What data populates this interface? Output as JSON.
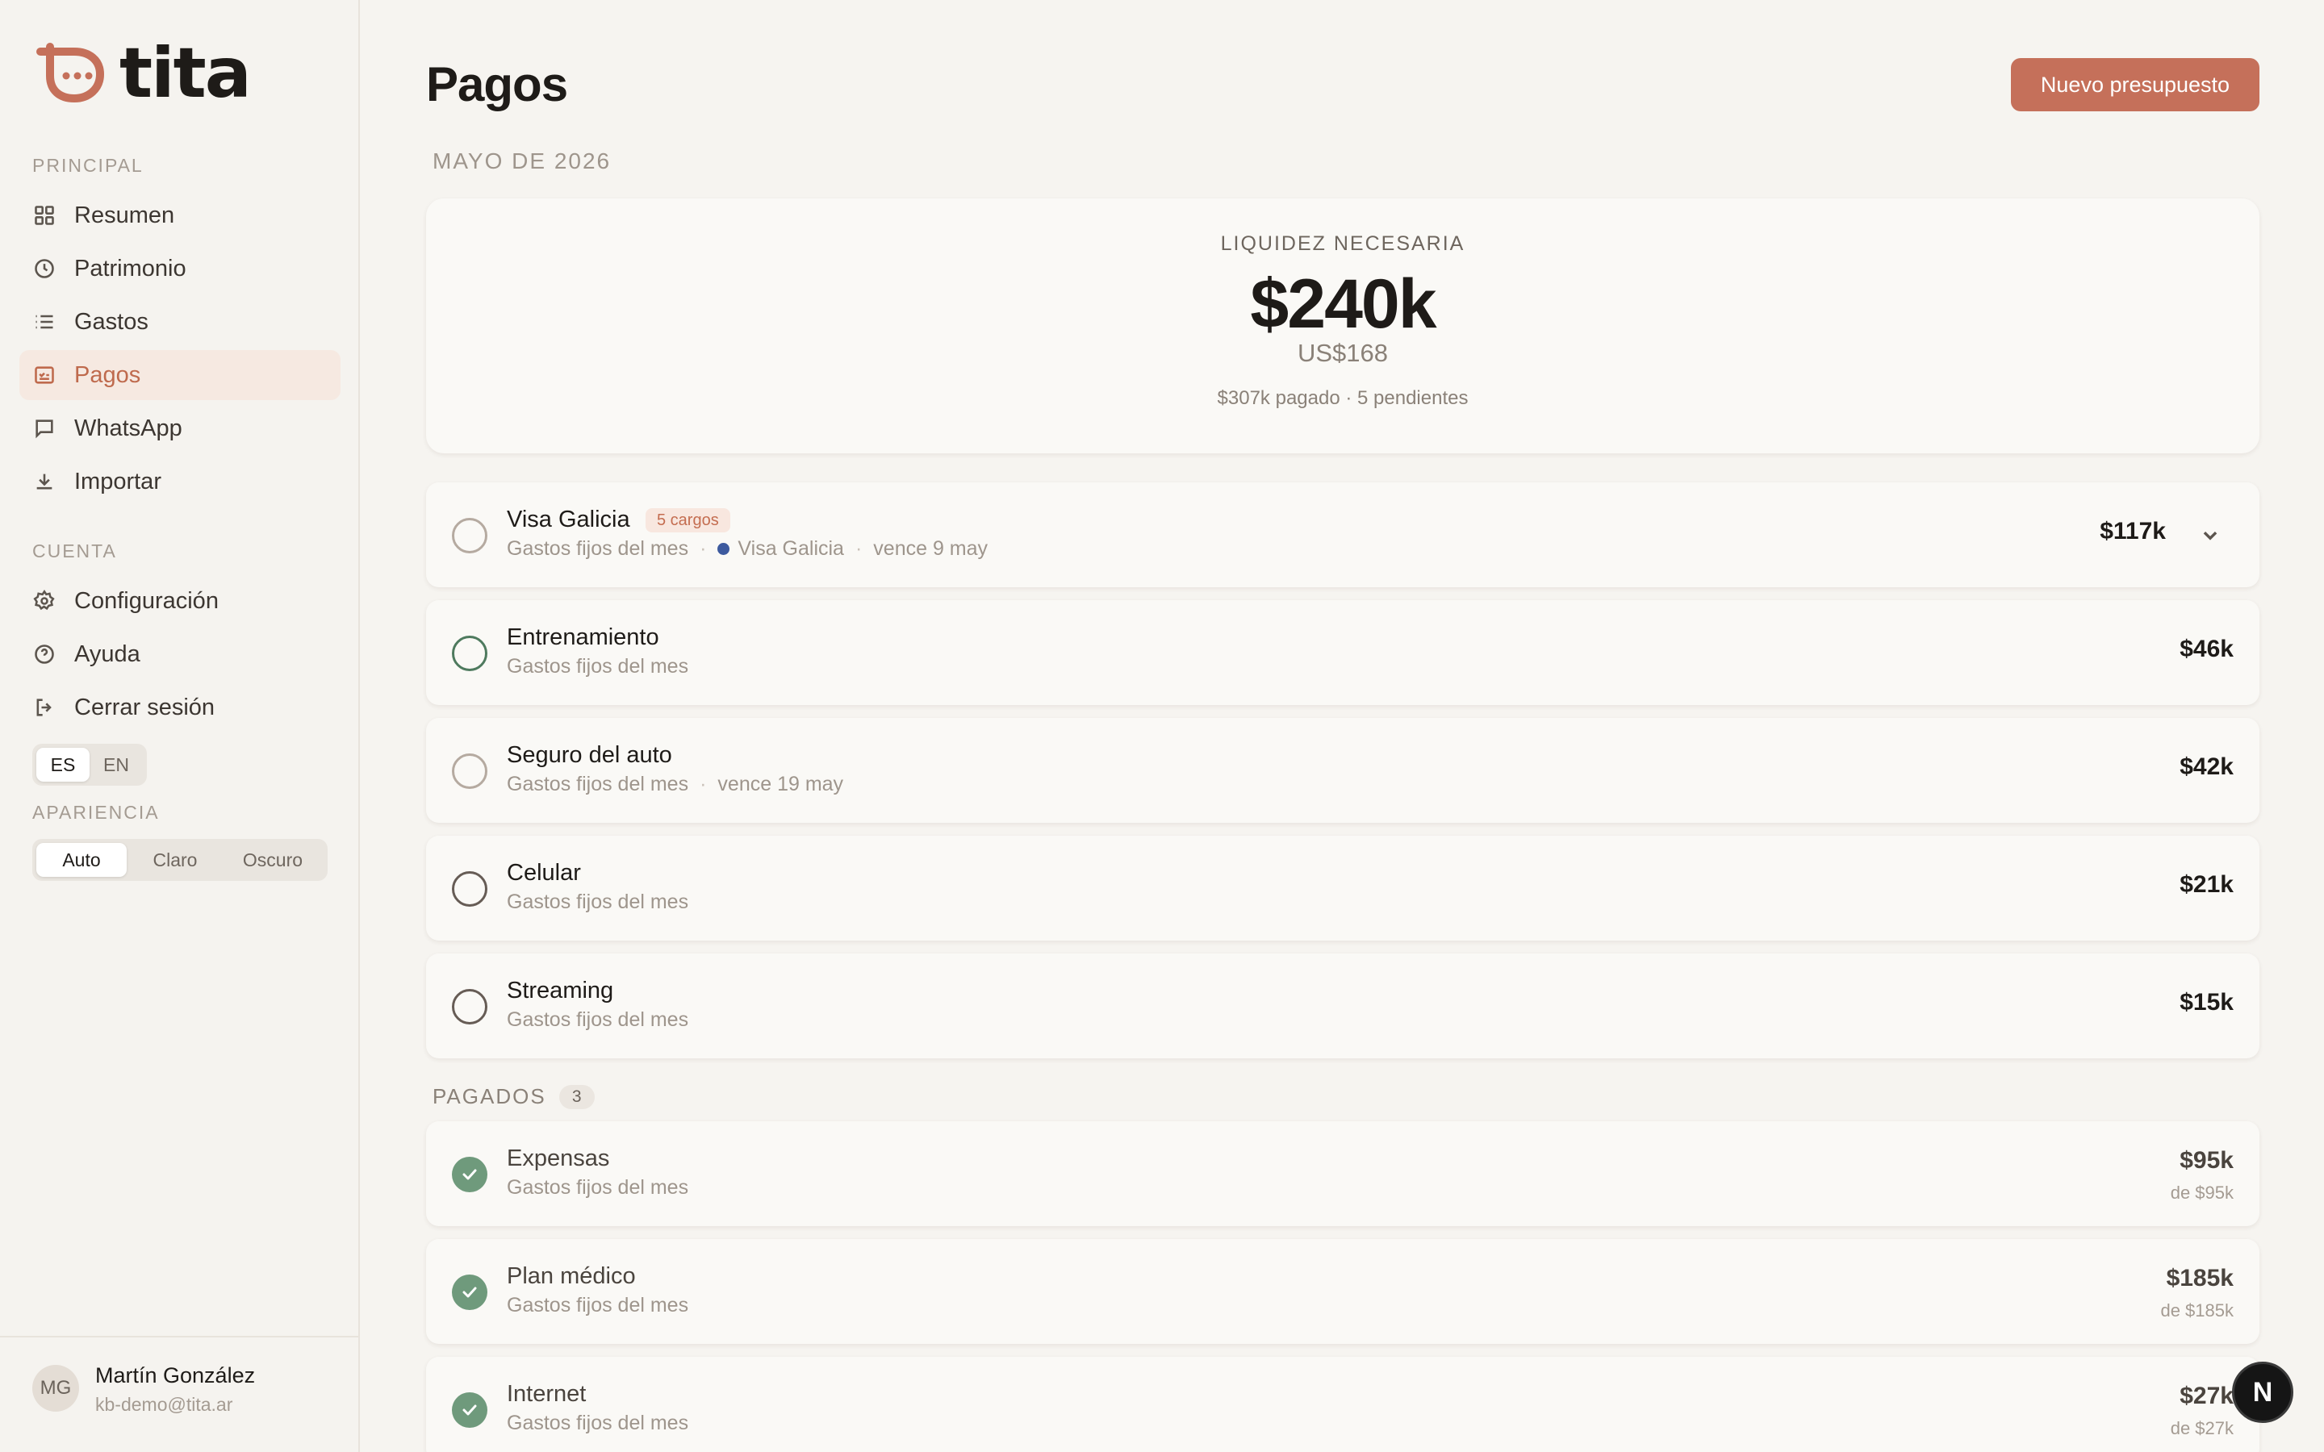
{
  "brand": {
    "name": "tita",
    "accent": "#c5705a"
  },
  "sidebar": {
    "section_main": "PRINCIPAL",
    "items_main": [
      {
        "label": "Resumen",
        "icon": "grid-icon"
      },
      {
        "label": "Patrimonio",
        "icon": "clock-icon"
      },
      {
        "label": "Gastos",
        "icon": "list-icon"
      },
      {
        "label": "Pagos",
        "icon": "checklist-icon",
        "active": true
      },
      {
        "label": "WhatsApp",
        "icon": "chat-icon"
      },
      {
        "label": "Importar",
        "icon": "download-icon"
      }
    ],
    "section_account": "CUENTA",
    "items_account": [
      {
        "label": "Configuración",
        "icon": "gear-icon"
      },
      {
        "label": "Ayuda",
        "icon": "help-icon"
      },
      {
        "label": "Cerrar sesión",
        "icon": "logout-icon"
      }
    ],
    "language": {
      "options": [
        "ES",
        "EN"
      ],
      "selected": "ES"
    },
    "appearance_label": "APARIENCIA",
    "appearance": {
      "options": [
        "Auto",
        "Claro",
        "Oscuro"
      ],
      "selected": "Auto"
    },
    "user": {
      "initials": "MG",
      "name": "Martín González",
      "email": "kb-demo@tita.ar"
    }
  },
  "header": {
    "title": "Pagos",
    "new_button": "Nuevo presupuesto"
  },
  "period": "MAYO DE 2026",
  "summary": {
    "label": "LIQUIDEZ NECESARIA",
    "amount": "$240k",
    "usd": "US$168",
    "sub": "$307k pagado · 5 pendientes"
  },
  "pending": [
    {
      "title": "Visa Galicia",
      "badge": "5 cargos",
      "category": "Gastos fijos del mes",
      "card": "Visa Galicia",
      "due": "vence 9 may",
      "amount": "$117k",
      "expandable": true,
      "check": "light"
    },
    {
      "title": "Entrenamiento",
      "category": "Gastos fijos del mes",
      "amount": "$46k",
      "check": "green"
    },
    {
      "title": "Seguro del auto",
      "category": "Gastos fijos del mes",
      "due": "vence 19 may",
      "amount": "$42k",
      "check": "light"
    },
    {
      "title": "Celular",
      "category": "Gastos fijos del mes",
      "amount": "$21k",
      "check": "dark"
    },
    {
      "title": "Streaming",
      "category": "Gastos fijos del mes",
      "amount": "$15k",
      "check": "dark"
    }
  ],
  "paid_section": {
    "label": "PAGADOS",
    "count": "3"
  },
  "paid": [
    {
      "title": "Expensas",
      "category": "Gastos fijos del mes",
      "amount": "$95k",
      "of": "de $95k"
    },
    {
      "title": "Plan médico",
      "category": "Gastos fijos del mes",
      "amount": "$185k",
      "of": "de $185k"
    },
    {
      "title": "Internet",
      "category": "Gastos fijos del mes",
      "amount": "$27k",
      "of": "de $27k"
    }
  ],
  "fab": {
    "label": "N"
  }
}
